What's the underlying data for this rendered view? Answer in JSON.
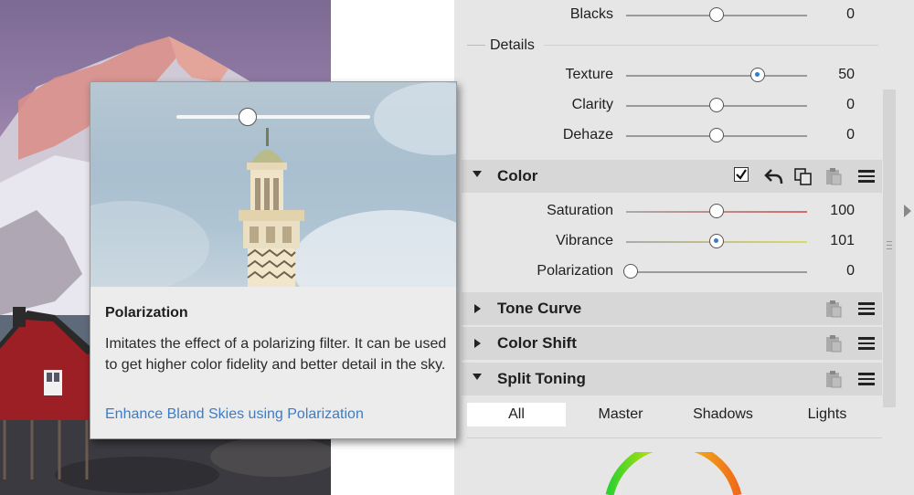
{
  "details_header": "Details",
  "sliders_top": [
    {
      "label": "Blacks",
      "value": "0",
      "pos": 0.5,
      "style": "plain"
    },
    {
      "label": "Texture",
      "value": "50",
      "pos": 0.75,
      "style": "dot"
    },
    {
      "label": "Clarity",
      "value": "0",
      "pos": 0.5,
      "style": "plain"
    },
    {
      "label": "Dehaze",
      "value": "0",
      "pos": 0.5,
      "style": "plain"
    }
  ],
  "color_section": {
    "title": "Color",
    "enabled": true,
    "sliders": [
      {
        "label": "Saturation",
        "value": "100",
        "pos": 0.5,
        "style": "plain",
        "track_color": "#d66a6a"
      },
      {
        "label": "Vibrance",
        "value": "101",
        "pos": 0.5,
        "style": "dot",
        "track_color": "#d4d06a"
      },
      {
        "label": "Polarization",
        "value": "0",
        "pos": 0.0,
        "style": "plain",
        "track_color": "#9a9a9a"
      }
    ]
  },
  "collapsed_sections": [
    {
      "title": "Tone Curve"
    },
    {
      "title": "Color Shift"
    }
  ],
  "split_toning": {
    "title": "Split Toning",
    "tabs": [
      "All",
      "Master",
      "Shadows",
      "Lights"
    ],
    "active_tab": "All"
  },
  "tooltip": {
    "title": "Polarization",
    "description": "Imitates the effect of a polarizing filter. It can be used to get higher color fidelity and better detail in the sky.",
    "link": "Enhance Bland Skies using Polarization",
    "slider_pos": 0.4
  },
  "icons": {
    "check": "checkbox-checked-icon",
    "undo": "undo-icon",
    "copy": "copy-icon",
    "paste": "paste-icon",
    "menu": "menu-icon"
  }
}
